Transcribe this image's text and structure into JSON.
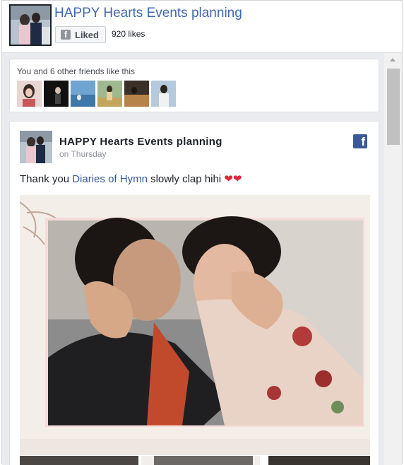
{
  "header": {
    "page_name": "HAPPY Hearts Events planning",
    "like_button_label": "Liked",
    "likes_count": "920 likes"
  },
  "friends": {
    "text": "You and 6 other friends like this"
  },
  "post": {
    "author": "HAPPY Hearts Events planning",
    "time": "on Thursday",
    "text_before": "Thank you",
    "mention": "Diaries of Hymn",
    "text_after": "slowly clap hihi",
    "emoji": "❤❤"
  },
  "icons": {
    "like": "facebook-f-icon",
    "logo": "facebook-logo-icon",
    "scroll_up": "scroll-up-arrow-icon"
  },
  "colors": {
    "link": "#4267b2",
    "facebook_blue": "#3b5998",
    "background": "#e9ebee",
    "heart": "#e0263b"
  }
}
